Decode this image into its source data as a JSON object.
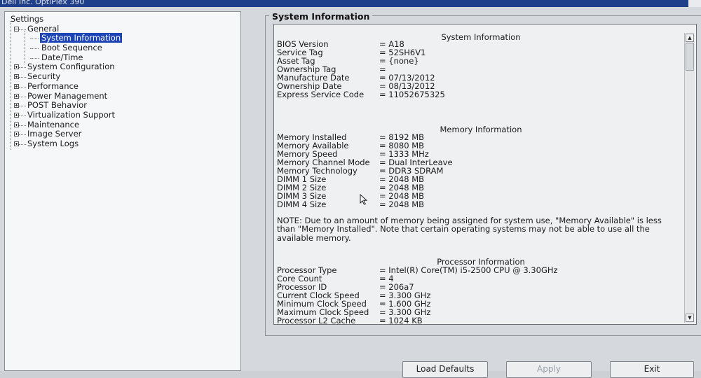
{
  "window": {
    "title": "Dell Inc. OptiPlex 390"
  },
  "tree": {
    "root": "Settings",
    "general": "General",
    "general_children": [
      "System Information",
      "Boot Sequence",
      "Date/Time"
    ],
    "items": [
      "System Configuration",
      "Security",
      "Performance",
      "Power Management",
      "POST Behavior",
      "Virtualization Support",
      "Maintenance",
      "Image Server",
      "System Logs"
    ],
    "selected": "System Information"
  },
  "panel": {
    "group_title": "System Information",
    "system": {
      "title": "System Information",
      "rows": [
        {
          "k": "BIOS Version",
          "v": "= A18"
        },
        {
          "k": "Service Tag",
          "v": "= 52SH6V1"
        },
        {
          "k": "Asset Tag",
          "v": "= {none}"
        },
        {
          "k": "Ownership Tag",
          "v": "="
        },
        {
          "k": "Manufacture Date",
          "v": "= 07/13/2012"
        },
        {
          "k": "Ownership Date",
          "v": "= 08/13/2012"
        },
        {
          "k": "Express Service Code",
          "v": "= 11052675325"
        }
      ]
    },
    "memory": {
      "title": "Memory Information",
      "rows": [
        {
          "k": "Memory Installed",
          "v": "= 8192 MB"
        },
        {
          "k": "Memory Available",
          "v": "= 8080 MB"
        },
        {
          "k": "Memory Speed",
          "v": "= 1333 MHz"
        },
        {
          "k": "Memory Channel Mode",
          "v": "= Dual InterLeave"
        },
        {
          "k": "Memory Technology",
          "v": "= DDR3 SDRAM"
        },
        {
          "k": "DIMM 1 Size",
          "v": "= 2048 MB"
        },
        {
          "k": "DIMM 2 Size",
          "v": "= 2048 MB"
        },
        {
          "k": "DIMM 3 Size",
          "v": "= 2048 MB"
        },
        {
          "k": "DIMM 4 Size",
          "v": "= 2048 MB"
        }
      ],
      "note": "NOTE: Due to an amount of memory being assigned for system use, \"Memory Available\" is less than \"Memory Installed\". Note that certain operating systems may not be able to use all the available memory."
    },
    "processor": {
      "title": "Processor Information",
      "rows": [
        {
          "k": "Processor Type",
          "v": "= Intel(R) Core(TM) i5-2500 CPU @ 3.30GHz"
        },
        {
          "k": "Core Count",
          "v": "= 4"
        },
        {
          "k": "Processor ID",
          "v": "= 206a7"
        },
        {
          "k": "Current Clock Speed",
          "v": "= 3.300 GHz"
        },
        {
          "k": "Minimum Clock Speed",
          "v": "= 1.600 GHz"
        },
        {
          "k": "Maximum Clock Speed",
          "v": "= 3.300 GHz"
        },
        {
          "k": "Processor L2 Cache",
          "v": "= 1024 KB"
        }
      ]
    }
  },
  "buttons": {
    "load_defaults": "Load Defaults",
    "apply": "Apply",
    "exit": "Exit"
  },
  "icons": {
    "scroll_up": "scroll-up-arrow-icon",
    "scroll_down": "scroll-down-arrow-icon",
    "cursor": "mouse-pointer-icon"
  }
}
